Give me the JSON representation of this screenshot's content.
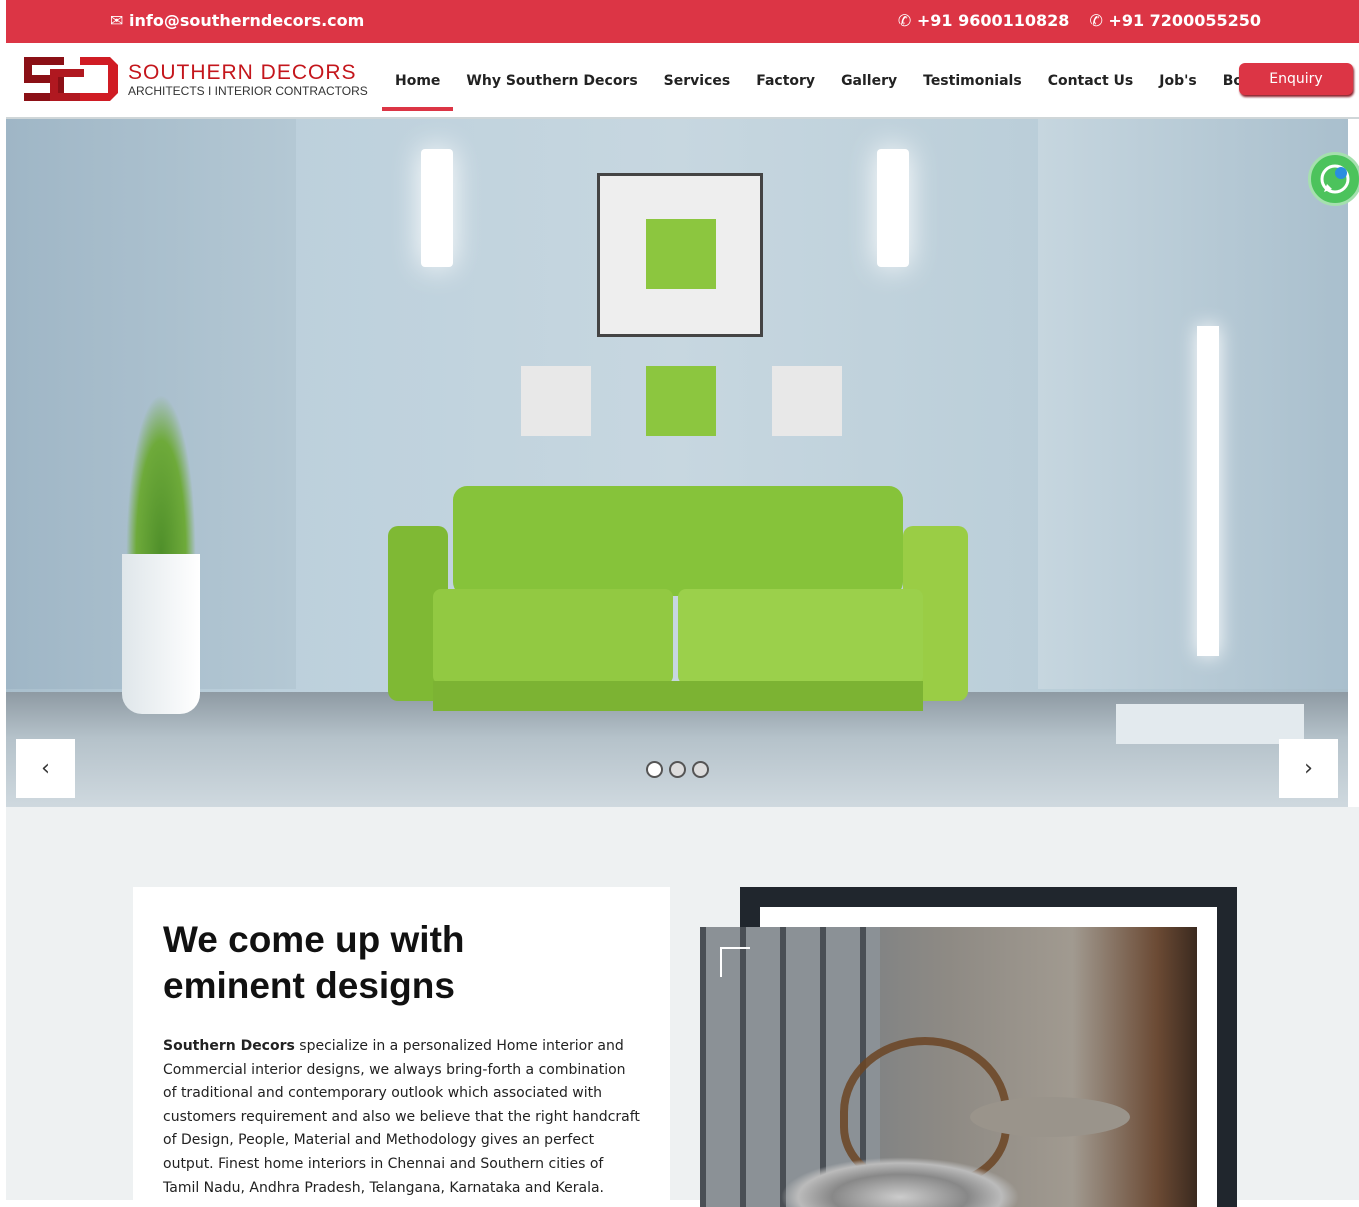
{
  "topbar": {
    "email": "info@southerndecors.com",
    "phone1": "+91 9600110828",
    "phone2": "+91 7200055250",
    "colors": {
      "primary": "#dc3545"
    }
  },
  "logo": {
    "title": "SOUTHERN DECORS",
    "subtitle": "ARCHITECTS I INTERIOR CONTRACTORS"
  },
  "nav": {
    "items": [
      {
        "label": "Home",
        "active": true
      },
      {
        "label": "Why Southern Decors"
      },
      {
        "label": "Services"
      },
      {
        "label": "Factory"
      },
      {
        "label": "Gallery"
      },
      {
        "label": "Testimonials"
      },
      {
        "label": "Contact Us"
      },
      {
        "label": "Job's"
      },
      {
        "label": "Booking"
      }
    ],
    "enquiry": "Enquiry"
  },
  "hero": {
    "prev": "‹",
    "next": "›",
    "slides": 3,
    "active_slide": 1
  },
  "about": {
    "heading_line1": "We come up with",
    "heading_line2": "eminent designs",
    "brand": "Southern Decors",
    "body": " specialize in a personalized Home interior and Commercial interior designs, we always bring-forth a combination of traditional and contemporary outlook which associated with customers requirement and also we believe that the right handcraft of Design, People, Material and Methodology gives an perfect output. Finest home interiors in Chennai and Southern cities of Tamil Nadu, Andhra Pradesh, Telangana, Karnataka and Kerala."
  }
}
